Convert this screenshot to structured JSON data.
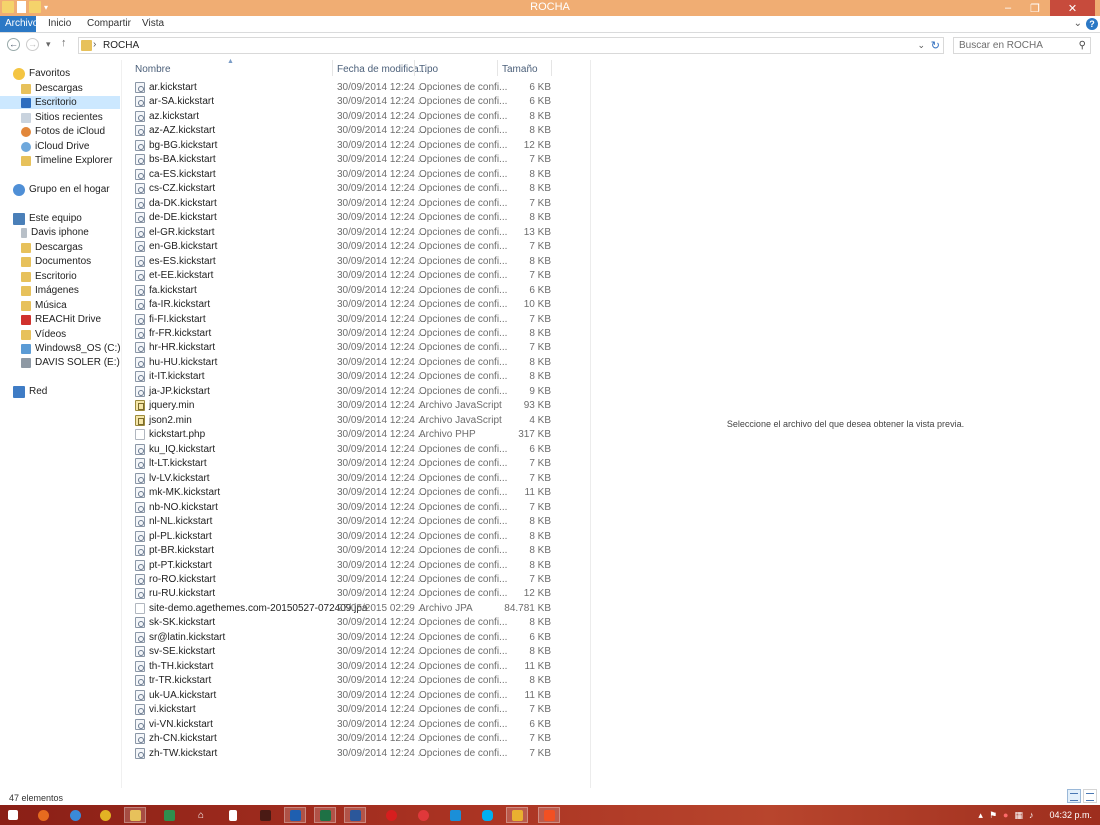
{
  "window": {
    "title": "ROCHA",
    "min": "–",
    "max": "❐",
    "close": "✕"
  },
  "ribbon": {
    "tabs": [
      "Archivo",
      "Inicio",
      "Compartir",
      "Vista"
    ],
    "expand": "⌄",
    "help": "?"
  },
  "address": {
    "crumb": "ROCHA",
    "search_placeholder": "Buscar en ROCHA",
    "back": "←",
    "forward": "→",
    "recent": "▾",
    "up": "↑",
    "sep": "›",
    "dropdown": "⌄",
    "refresh": "↻",
    "search_icon": "⚲"
  },
  "colors": {
    "title_bar": "#f0ad73",
    "file_tab": "#2b78c5",
    "selection": "#cce8ff",
    "close_button": "#c74b3c",
    "taskbar": "#a93222"
  },
  "nav": {
    "favorites": {
      "label": "Favoritos",
      "items": [
        "Descargas",
        "Escritorio",
        "Sitios recientes",
        "Fotos de iCloud",
        "iCloud Drive",
        "Timeline Explorer"
      ]
    },
    "homegroup": "Grupo en el hogar",
    "pc": {
      "label": "Este equipo",
      "items": [
        "Davis iphone",
        "Descargas",
        "Documentos",
        "Escritorio",
        "Imágenes",
        "Música",
        "REACHit Drive",
        "Vídeos",
        "Windows8_OS (C:)",
        "DAVIS SOLER (E:)"
      ]
    },
    "network": "Red"
  },
  "columns": {
    "name": "Nombre",
    "date": "Fecha de modifica...",
    "type": "Tipo",
    "size": "Tamaño"
  },
  "files": [
    {
      "name": "ar.kickstart",
      "date": "30/09/2014 12:24 ...",
      "type": "Opciones de confi...",
      "size": "6 KB",
      "icon": "cfg"
    },
    {
      "name": "ar-SA.kickstart",
      "date": "30/09/2014 12:24 ...",
      "type": "Opciones de confi...",
      "size": "6 KB",
      "icon": "cfg"
    },
    {
      "name": "az.kickstart",
      "date": "30/09/2014 12:24 ...",
      "type": "Opciones de confi...",
      "size": "8 KB",
      "icon": "cfg"
    },
    {
      "name": "az-AZ.kickstart",
      "date": "30/09/2014 12:24 ...",
      "type": "Opciones de confi...",
      "size": "8 KB",
      "icon": "cfg"
    },
    {
      "name": "bg-BG.kickstart",
      "date": "30/09/2014 12:24 ...",
      "type": "Opciones de confi...",
      "size": "12 KB",
      "icon": "cfg"
    },
    {
      "name": "bs-BA.kickstart",
      "date": "30/09/2014 12:24 ...",
      "type": "Opciones de confi...",
      "size": "7 KB",
      "icon": "cfg"
    },
    {
      "name": "ca-ES.kickstart",
      "date": "30/09/2014 12:24 ...",
      "type": "Opciones de confi...",
      "size": "8 KB",
      "icon": "cfg"
    },
    {
      "name": "cs-CZ.kickstart",
      "date": "30/09/2014 12:24 ...",
      "type": "Opciones de confi...",
      "size": "8 KB",
      "icon": "cfg"
    },
    {
      "name": "da-DK.kickstart",
      "date": "30/09/2014 12:24 ...",
      "type": "Opciones de confi...",
      "size": "7 KB",
      "icon": "cfg"
    },
    {
      "name": "de-DE.kickstart",
      "date": "30/09/2014 12:24 ...",
      "type": "Opciones de confi...",
      "size": "8 KB",
      "icon": "cfg"
    },
    {
      "name": "el-GR.kickstart",
      "date": "30/09/2014 12:24 ...",
      "type": "Opciones de confi...",
      "size": "13 KB",
      "icon": "cfg"
    },
    {
      "name": "en-GB.kickstart",
      "date": "30/09/2014 12:24 ...",
      "type": "Opciones de confi...",
      "size": "7 KB",
      "icon": "cfg"
    },
    {
      "name": "es-ES.kickstart",
      "date": "30/09/2014 12:24 ...",
      "type": "Opciones de confi...",
      "size": "8 KB",
      "icon": "cfg"
    },
    {
      "name": "et-EE.kickstart",
      "date": "30/09/2014 12:24 ...",
      "type": "Opciones de confi...",
      "size": "7 KB",
      "icon": "cfg"
    },
    {
      "name": "fa.kickstart",
      "date": "30/09/2014 12:24 ...",
      "type": "Opciones de confi...",
      "size": "6 KB",
      "icon": "cfg"
    },
    {
      "name": "fa-IR.kickstart",
      "date": "30/09/2014 12:24 ...",
      "type": "Opciones de confi...",
      "size": "10 KB",
      "icon": "cfg"
    },
    {
      "name": "fi-FI.kickstart",
      "date": "30/09/2014 12:24 ...",
      "type": "Opciones de confi...",
      "size": "7 KB",
      "icon": "cfg"
    },
    {
      "name": "fr-FR.kickstart",
      "date": "30/09/2014 12:24 ...",
      "type": "Opciones de confi...",
      "size": "8 KB",
      "icon": "cfg"
    },
    {
      "name": "hr-HR.kickstart",
      "date": "30/09/2014 12:24 ...",
      "type": "Opciones de confi...",
      "size": "7 KB",
      "icon": "cfg"
    },
    {
      "name": "hu-HU.kickstart",
      "date": "30/09/2014 12:24 ...",
      "type": "Opciones de confi...",
      "size": "8 KB",
      "icon": "cfg"
    },
    {
      "name": "it-IT.kickstart",
      "date": "30/09/2014 12:24 ...",
      "type": "Opciones de confi...",
      "size": "8 KB",
      "icon": "cfg"
    },
    {
      "name": "ja-JP.kickstart",
      "date": "30/09/2014 12:24 ...",
      "type": "Opciones de confi...",
      "size": "9 KB",
      "icon": "cfg"
    },
    {
      "name": "jquery.min",
      "date": "30/09/2014 12:24 ...",
      "type": "Archivo JavaScript",
      "size": "93 KB",
      "icon": "js"
    },
    {
      "name": "json2.min",
      "date": "30/09/2014 12:24 ...",
      "type": "Archivo JavaScript",
      "size": "4 KB",
      "icon": "js"
    },
    {
      "name": "kickstart.php",
      "date": "30/09/2014 12:24 ...",
      "type": "Archivo PHP",
      "size": "317 KB",
      "icon": "plain"
    },
    {
      "name": "ku_IQ.kickstart",
      "date": "30/09/2014 12:24 ...",
      "type": "Opciones de confi...",
      "size": "6 KB",
      "icon": "cfg"
    },
    {
      "name": "lt-LT.kickstart",
      "date": "30/09/2014 12:24 ...",
      "type": "Opciones de confi...",
      "size": "7 KB",
      "icon": "cfg"
    },
    {
      "name": "lv-LV.kickstart",
      "date": "30/09/2014 12:24 ...",
      "type": "Opciones de confi...",
      "size": "7 KB",
      "icon": "cfg"
    },
    {
      "name": "mk-MK.kickstart",
      "date": "30/09/2014 12:24 ...",
      "type": "Opciones de confi...",
      "size": "11 KB",
      "icon": "cfg"
    },
    {
      "name": "nb-NO.kickstart",
      "date": "30/09/2014 12:24 ...",
      "type": "Opciones de confi...",
      "size": "7 KB",
      "icon": "cfg"
    },
    {
      "name": "nl-NL.kickstart",
      "date": "30/09/2014 12:24 ...",
      "type": "Opciones de confi...",
      "size": "8 KB",
      "icon": "cfg"
    },
    {
      "name": "pl-PL.kickstart",
      "date": "30/09/2014 12:24 ...",
      "type": "Opciones de confi...",
      "size": "8 KB",
      "icon": "cfg"
    },
    {
      "name": "pt-BR.kickstart",
      "date": "30/09/2014 12:24 ...",
      "type": "Opciones de confi...",
      "size": "8 KB",
      "icon": "cfg"
    },
    {
      "name": "pt-PT.kickstart",
      "date": "30/09/2014 12:24 ...",
      "type": "Opciones de confi...",
      "size": "8 KB",
      "icon": "cfg"
    },
    {
      "name": "ro-RO.kickstart",
      "date": "30/09/2014 12:24 ...",
      "type": "Opciones de confi...",
      "size": "7 KB",
      "icon": "cfg"
    },
    {
      "name": "ru-RU.kickstart",
      "date": "30/09/2014 12:24 ...",
      "type": "Opciones de confi...",
      "size": "12 KB",
      "icon": "cfg"
    },
    {
      "name": "site-demo.agethemes.com-20150527-072409.jpa",
      "date": "27/05/2015 02:29 ...",
      "type": "Archivo JPA",
      "size": "84.781 KB",
      "icon": "plain"
    },
    {
      "name": "sk-SK.kickstart",
      "date": "30/09/2014 12:24 ...",
      "type": "Opciones de confi...",
      "size": "8 KB",
      "icon": "cfg"
    },
    {
      "name": "sr@latin.kickstart",
      "date": "30/09/2014 12:24 ...",
      "type": "Opciones de confi...",
      "size": "6 KB",
      "icon": "cfg"
    },
    {
      "name": "sv-SE.kickstart",
      "date": "30/09/2014 12:24 ...",
      "type": "Opciones de confi...",
      "size": "8 KB",
      "icon": "cfg"
    },
    {
      "name": "th-TH.kickstart",
      "date": "30/09/2014 12:24 ...",
      "type": "Opciones de confi...",
      "size": "11 KB",
      "icon": "cfg"
    },
    {
      "name": "tr-TR.kickstart",
      "date": "30/09/2014 12:24 ...",
      "type": "Opciones de confi...",
      "size": "8 KB",
      "icon": "cfg"
    },
    {
      "name": "uk-UA.kickstart",
      "date": "30/09/2014 12:24 ...",
      "type": "Opciones de confi...",
      "size": "11 KB",
      "icon": "cfg"
    },
    {
      "name": "vi.kickstart",
      "date": "30/09/2014 12:24 ...",
      "type": "Opciones de confi...",
      "size": "7 KB",
      "icon": "cfg"
    },
    {
      "name": "vi-VN.kickstart",
      "date": "30/09/2014 12:24 ...",
      "type": "Opciones de confi...",
      "size": "6 KB",
      "icon": "cfg"
    },
    {
      "name": "zh-CN.kickstart",
      "date": "30/09/2014 12:24 ...",
      "type": "Opciones de confi...",
      "size": "7 KB",
      "icon": "cfg"
    },
    {
      "name": "zh-TW.kickstart",
      "date": "30/09/2014 12:24 ...",
      "type": "Opciones de confi...",
      "size": "7 KB",
      "icon": "cfg"
    }
  ],
  "preview": {
    "message": "Seleccione el archivo del que desea obtener la vista previa."
  },
  "status": {
    "count": "47 elementos"
  },
  "taskbar": {
    "clock": "04:32 p.m."
  }
}
